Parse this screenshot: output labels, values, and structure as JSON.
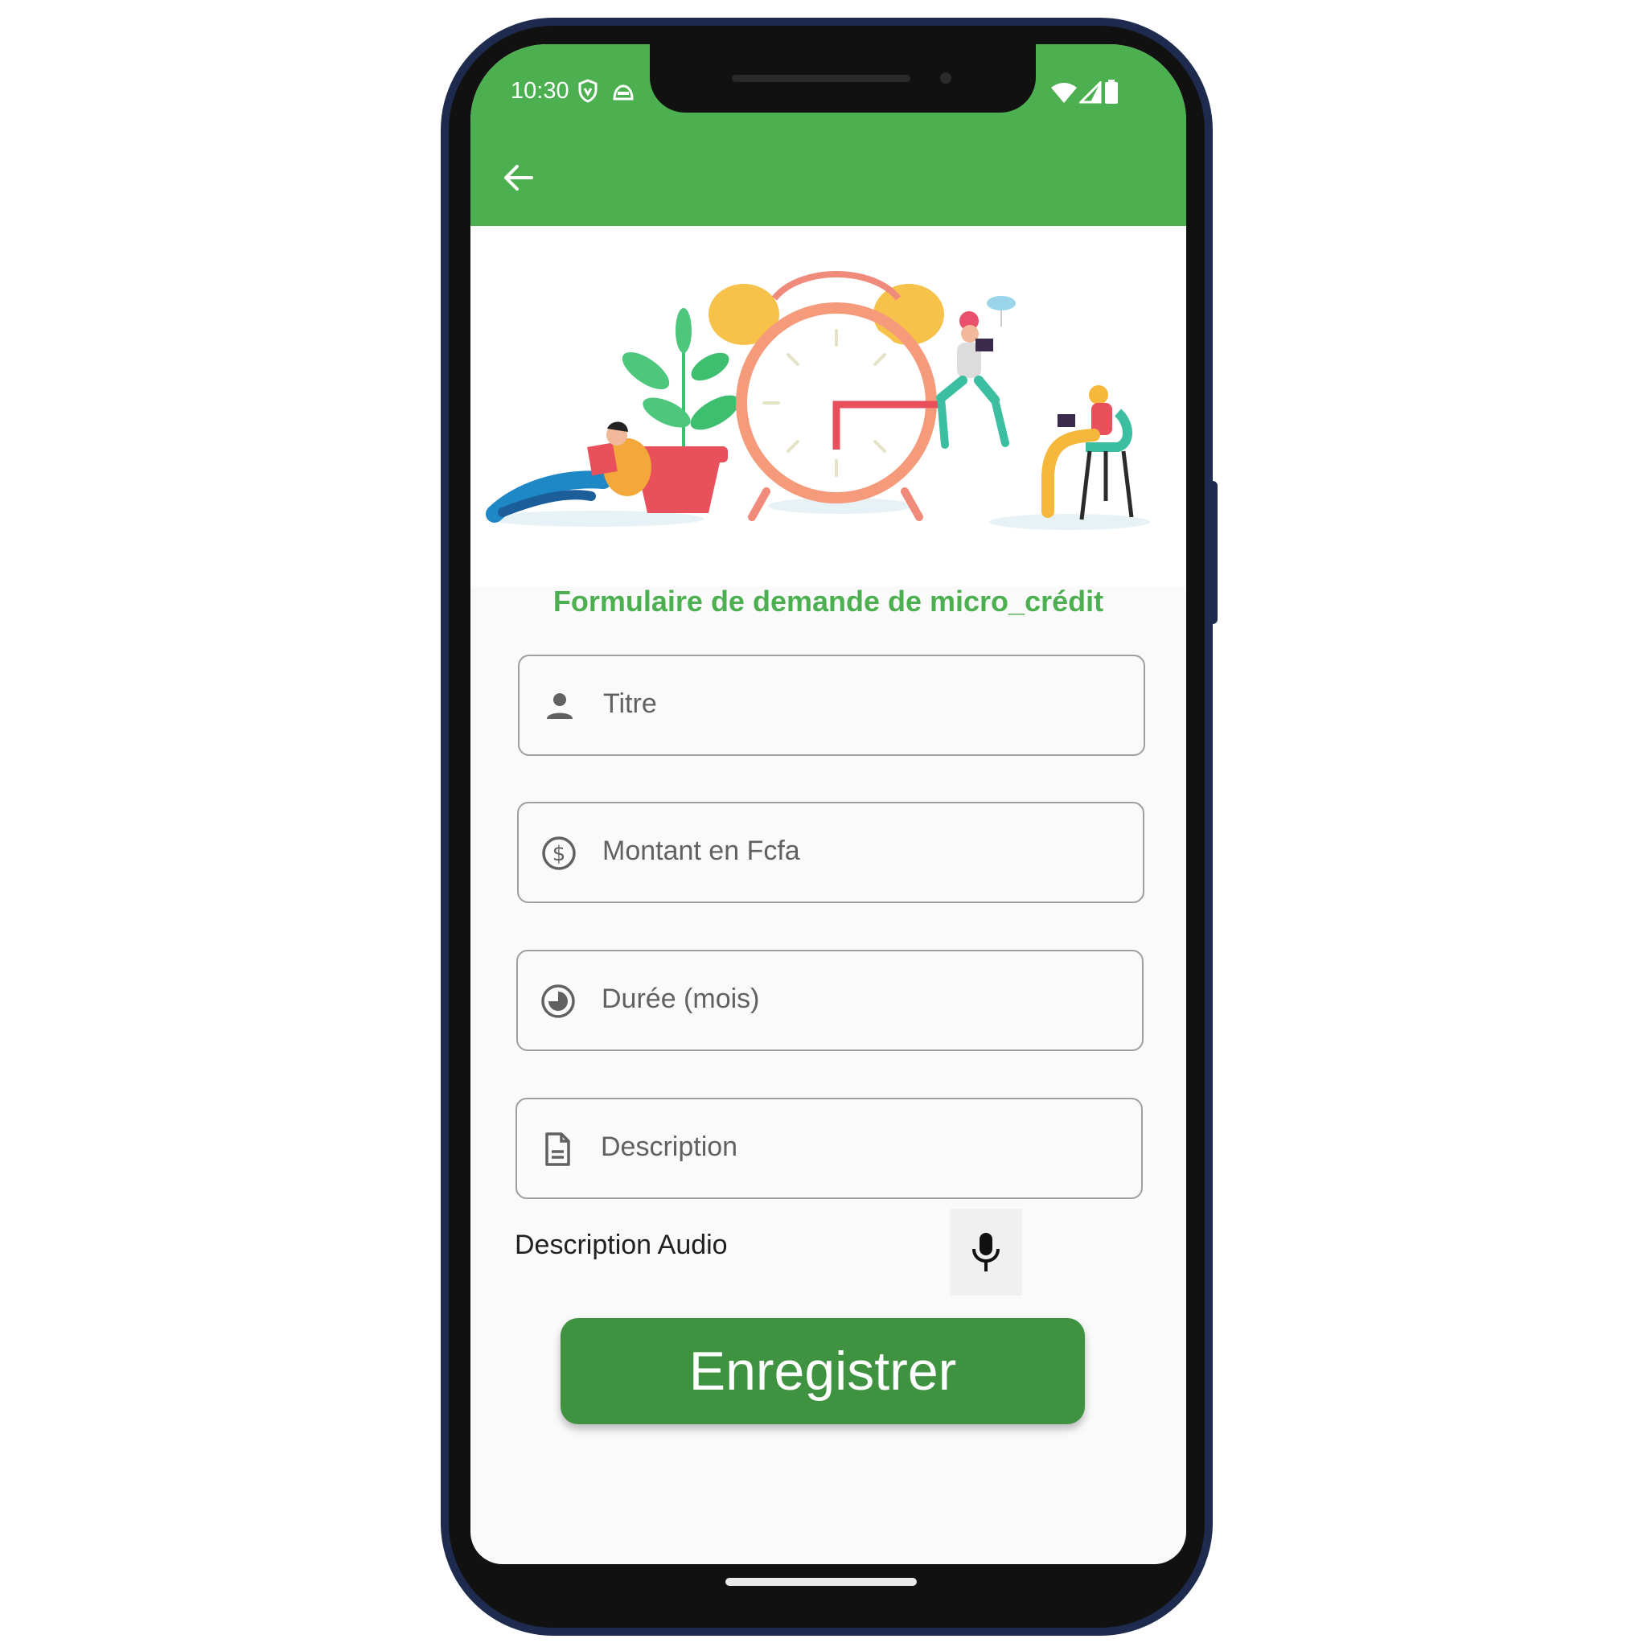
{
  "status_bar": {
    "time": "10:30",
    "icons": [
      "shield-icon",
      "android-face-icon",
      "wifi-icon",
      "signal-icon",
      "battery-icon"
    ]
  },
  "app_bar": {
    "back_icon": "arrow-left-icon"
  },
  "form": {
    "title": "Formulaire de demande de micro_crédit",
    "fields": [
      {
        "icon": "person-icon",
        "placeholder": "Titre"
      },
      {
        "icon": "dollar-circle-icon",
        "placeholder": "Montant en Fcfa"
      },
      {
        "icon": "clock-pie-icon",
        "placeholder": "Durée (mois)"
      },
      {
        "icon": "document-icon",
        "placeholder": "Description"
      }
    ],
    "audio_label": "Description Audio",
    "mic_icon": "microphone-icon",
    "submit_label": "Enregistrer"
  },
  "colors": {
    "primary": "#4caf50",
    "button": "#3f9340",
    "phone_frame": "#1f2b4e"
  }
}
